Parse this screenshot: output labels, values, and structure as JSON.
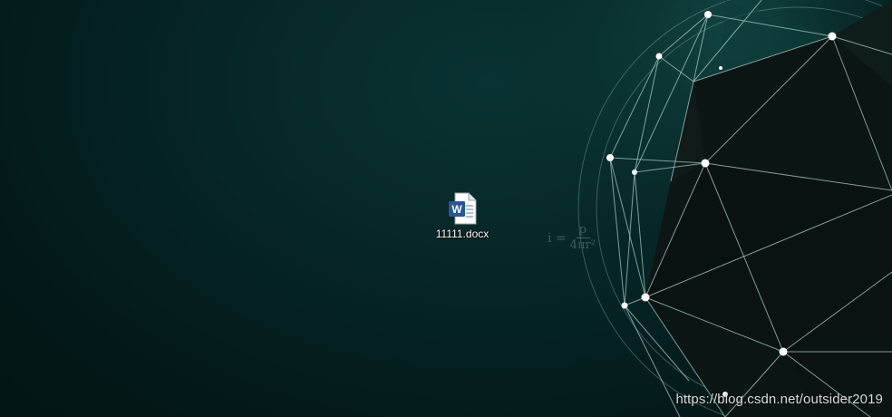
{
  "desktop": {
    "icons": [
      {
        "label": "11111.docx",
        "type": "word-document-icon"
      }
    ]
  },
  "wallpaper": {
    "formula_lhs": "i =",
    "formula_numerator": "p",
    "formula_denominator": "4πr²",
    "colors": {
      "background": "#052424",
      "line": "#8fbcb6",
      "node": "#ffffff",
      "polyhedron": "#0a1412"
    }
  },
  "watermark": "https://blog.csdn.net/outsider2019"
}
